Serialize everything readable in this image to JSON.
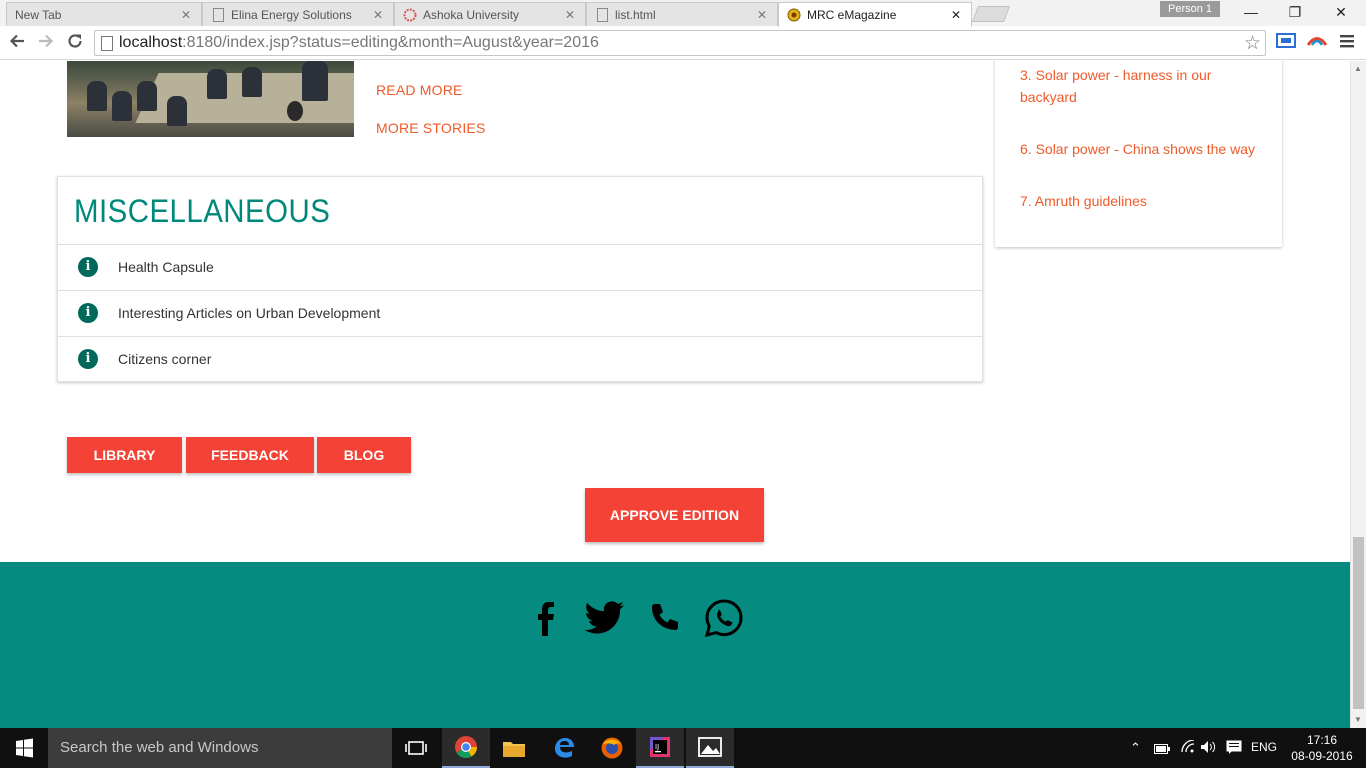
{
  "browser": {
    "tabs": [
      {
        "label": "New Tab",
        "icon": "none"
      },
      {
        "label": "Elina Energy Solutions",
        "icon": "page-icon"
      },
      {
        "label": "Ashoka University",
        "icon": "ashoka-logo"
      },
      {
        "label": "list.html",
        "icon": "page-icon"
      },
      {
        "label": "MRC eMagazine",
        "icon": "mrc-logo"
      }
    ],
    "active_tab": 4,
    "profile": "Person 1",
    "url_host": "localhost",
    "url_rest": ":8180/index.jsp?status=editing&month=August&year=2016"
  },
  "page": {
    "story_links": {
      "read_more": "READ MORE",
      "more_stories": "MORE STORIES"
    },
    "side_list": [
      "3. Solar power - harness in our backyard",
      "6. Solar power - China shows the way",
      "7. Amruth guidelines"
    ],
    "misc": {
      "title": "MISCELLANEOUS",
      "items": [
        "Health Capsule",
        "Interesting Articles on Urban Development",
        "Citizens corner"
      ]
    },
    "buttons": {
      "library": "LIBRARY",
      "feedback": "FEEDBACK",
      "blog": "BLOG",
      "approve": "APPROVE EDITION"
    },
    "social_icons": [
      "facebook-icon",
      "twitter-icon",
      "phone-icon",
      "whatsapp-icon"
    ],
    "colors": {
      "accent_link": "#f05a28",
      "teal": "#00897b",
      "footer": "#058b7f",
      "button": "#f44336"
    }
  },
  "taskbar": {
    "search_placeholder": "Search the web and Windows",
    "language": "ENG",
    "time": "17:16",
    "date": "08-09-2016"
  }
}
